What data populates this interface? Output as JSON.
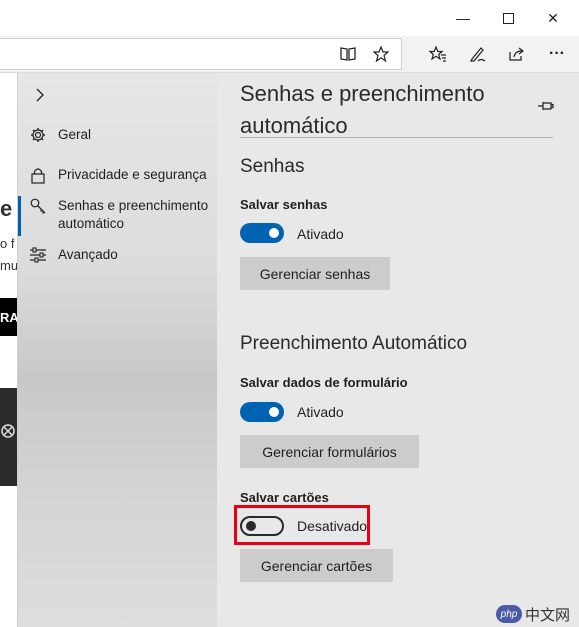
{
  "window": {
    "controls": {
      "minimize": "—",
      "maximize": "☐",
      "close": "✕"
    }
  },
  "toolbar": {
    "icons": [
      "reading-view-icon",
      "favorite-star-icon",
      "favorites-hub-icon",
      "pen-icon",
      "share-icon",
      "more-icon"
    ],
    "more_label": "···"
  },
  "page": {
    "fragments": [
      "e",
      "o f",
      "mu",
      "RA"
    ]
  },
  "nav": {
    "items": [
      {
        "label": "Geral",
        "icon": "gear-icon"
      },
      {
        "label": "Privacidade e segurança",
        "icon": "lock-icon"
      },
      {
        "label": "Senhas e preenchimento automático",
        "icon": "key-icon"
      },
      {
        "label": "Avançado",
        "icon": "sliders-icon"
      }
    ],
    "selected_index": 2
  },
  "settings": {
    "title": "Senhas e preenchimento automático",
    "passwords": {
      "heading": "Senhas",
      "save_label": "Salvar senhas",
      "save_state": "Ativado",
      "save_on": true,
      "manage_button": "Gerenciar senhas"
    },
    "autofill": {
      "heading": "Preenchimento Automático",
      "forms_label": "Salvar dados de formulário",
      "forms_state": "Ativado",
      "forms_on": true,
      "forms_button": "Gerenciar formulários",
      "cards_label": "Salvar cartões",
      "cards_state": "Desativado",
      "cards_on": false,
      "cards_button": "Gerenciar cartões"
    }
  },
  "watermark": {
    "badge": "php",
    "text": "中文网"
  },
  "colors": {
    "accent": "#0063b1",
    "highlight": "#e60012",
    "panel": "#e8e8e8",
    "button": "#cccccc"
  }
}
